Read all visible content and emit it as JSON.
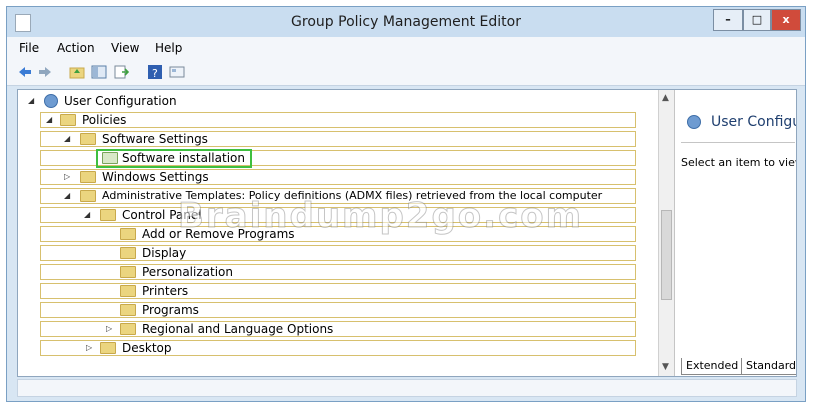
{
  "window": {
    "title": "Group Policy Management Editor",
    "min_glyph": "–",
    "max_glyph": "□",
    "close_glyph": "x"
  },
  "menu": [
    "File",
    "Action",
    "View",
    "Help"
  ],
  "toolbar": [
    "back-icon",
    "forward-icon",
    "up-folder-icon",
    "show-hide-tree-icon",
    "export-list-icon",
    "help-icon",
    "properties-icon"
  ],
  "tree": {
    "root": "User Configuration",
    "policies": "Policies",
    "software_settings": "Software Settings",
    "software_installation": "Software installation",
    "windows_settings": "Windows Settings",
    "admin_templates": "Administrative Templates: Policy definitions (ADMX files) retrieved from the local computer",
    "control_panel": "Control Panel",
    "add_remove": "Add or Remove Programs",
    "display": "Display",
    "personalization": "Personalization",
    "printers": "Printers",
    "programs": "Programs",
    "regional": "Regional and Language Options",
    "desktop": "Desktop"
  },
  "right_pane": {
    "title": "User Configura",
    "text": "Select an item to view its"
  },
  "tabs": [
    "Extended",
    "Standard"
  ],
  "watermark": "Braindump2go.com",
  "colors": {
    "selection_outline": "#3fbf3f",
    "title_bar": "#c9ddf0"
  }
}
